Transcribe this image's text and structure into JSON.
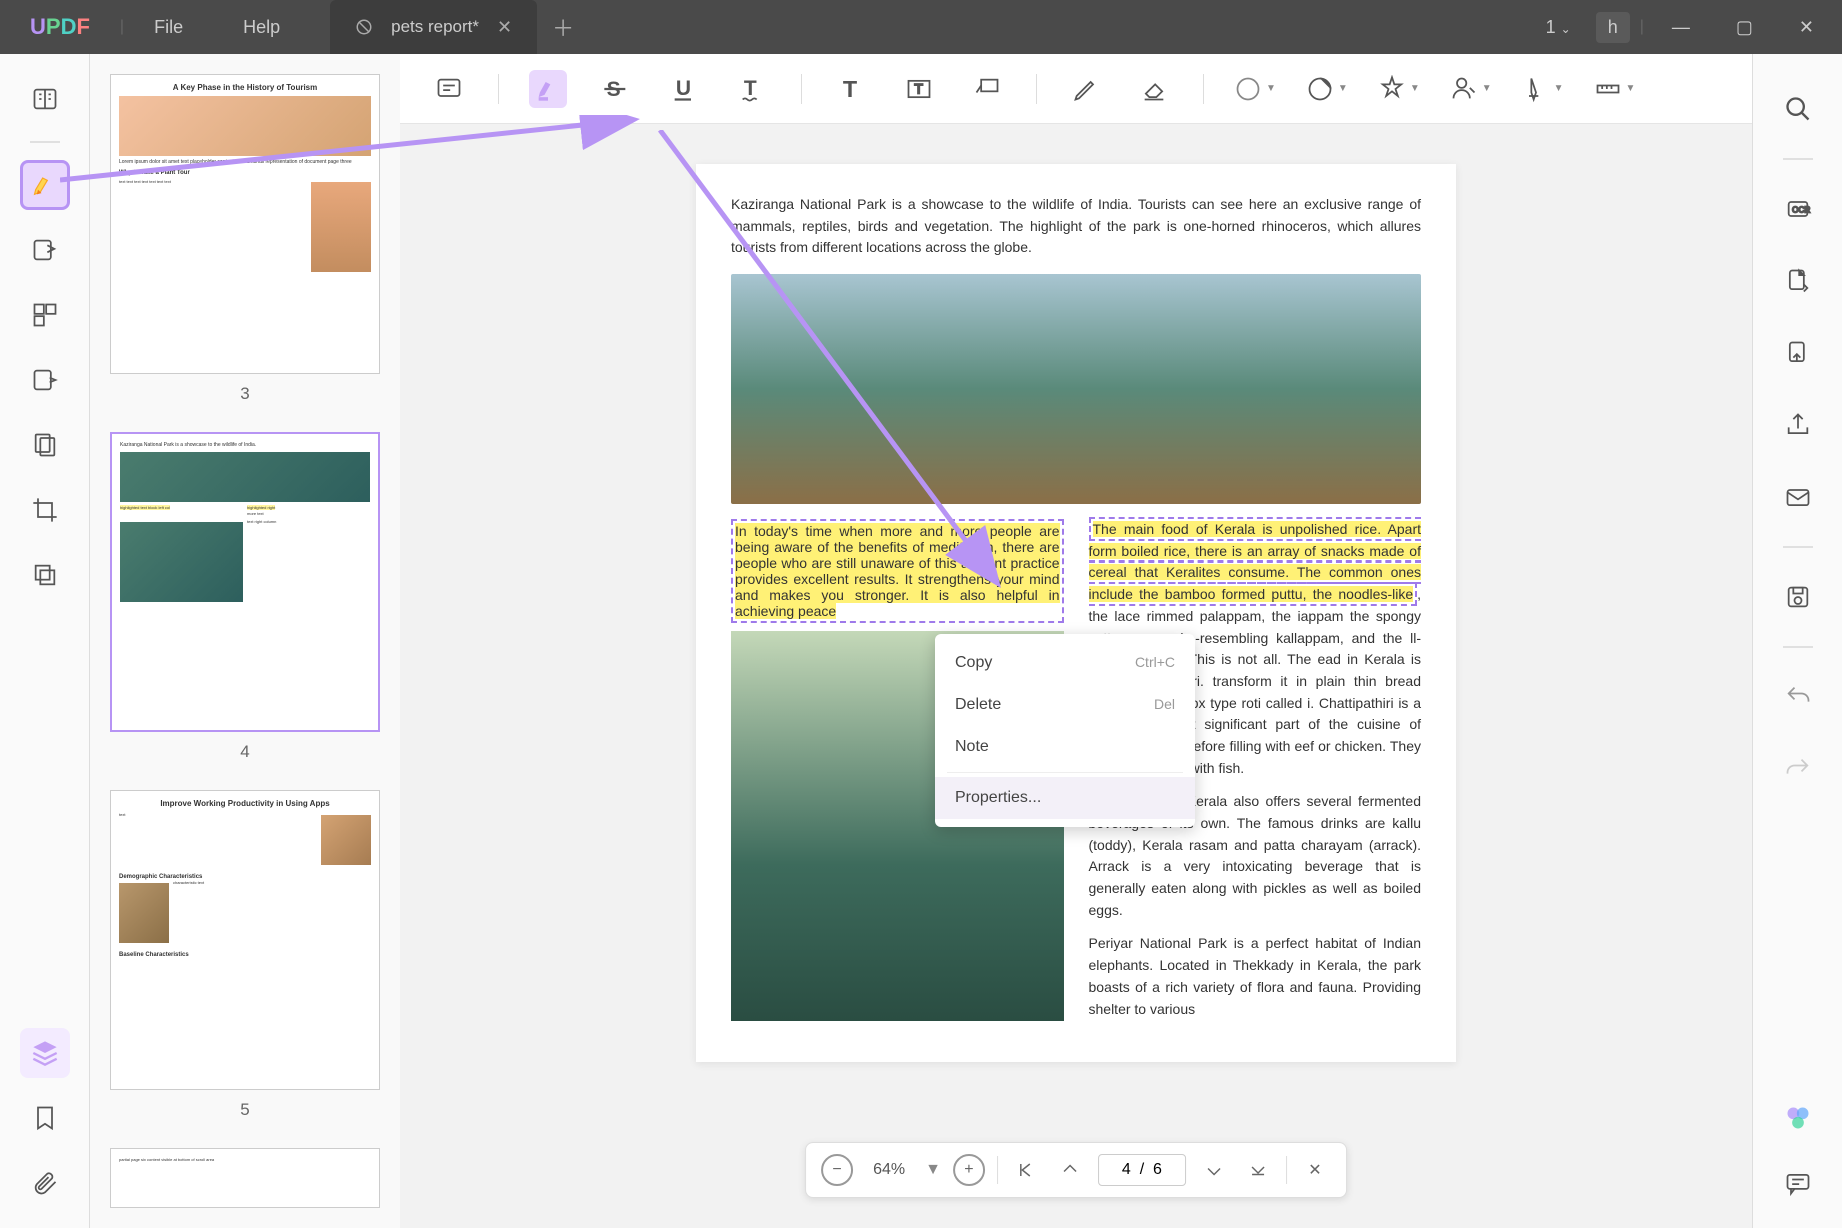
{
  "app": {
    "logo_u": "U",
    "logo_p": "P",
    "logo_d": "D",
    "logo_f": "F"
  },
  "menu": {
    "file": "File",
    "help": "Help"
  },
  "tab": {
    "title": "pets report*"
  },
  "titlebar_right": {
    "number": "1",
    "user": "h"
  },
  "thumbs": {
    "p3": {
      "num": "3",
      "title": "A Key Phase in the History of Tourism",
      "h1": "Why to Take a Plant Tour"
    },
    "p4": {
      "num": "4"
    },
    "p5": {
      "num": "5",
      "title": "Improve Working Productivity in Using Apps",
      "h1": "Demographic Characteristics",
      "h2": "Baseline Characteristics"
    }
  },
  "page": {
    "intro": "Kaziranga National Park is a showcase to the wildlife of India. Tourists can see here an exclusive range of mammals, reptiles, birds and vegetation. The highlight of the park is one-horned rhinoceros, which allures tourists from different locations across the globe.",
    "left_hl": "In today's time when more and more people are being aware of the benefits of meditation, there are people who are still unaware of this ancient practice provides excellent results. It strengthens your mind and makes you stronger. It is also helpful in achieving peace",
    "right_hl": "The main food of Kerala is unpolished rice. Apart form boiled rice, there is an array of snacks made of cereal that Keralites consume. The common ones include the bamboo formed puttu, the noodles-like",
    "right_rest": ", the lace rimmed palappam, the iappam the spongy vattayappam, ke-resembling kallappam, and the ll-like kozhikotta. This is not all. The ead in Kerala is called the pathiri. transform it in plain thin bread vatipathiri or a box type roti called i. Chattipathiri is a sweet cake that significant part of the cuisine of athiris are fried before filling with eef or chicken. They are steamed ed with fish.",
    "r2": "The cuisine of Kerala also offers several fermented beverages of its own. The famous drinks are kallu (toddy), Kerala rasam and patta charayam (arrack). Arrack is a very intoxicating beverage that is generally eaten along with pickles as well as boiled eggs.",
    "r3": "Periyar National Park is a perfect habitat of Indian elephants. Located in Thekkady in Kerala, the park boasts of a rich variety of flora and fauna. Providing shelter to various"
  },
  "context": {
    "copy": "Copy",
    "copy_sc": "Ctrl+C",
    "delete": "Delete",
    "delete_sc": "Del",
    "note": "Note",
    "props": "Properties..."
  },
  "pager": {
    "zoom": "64%",
    "page": "4  /  6"
  }
}
